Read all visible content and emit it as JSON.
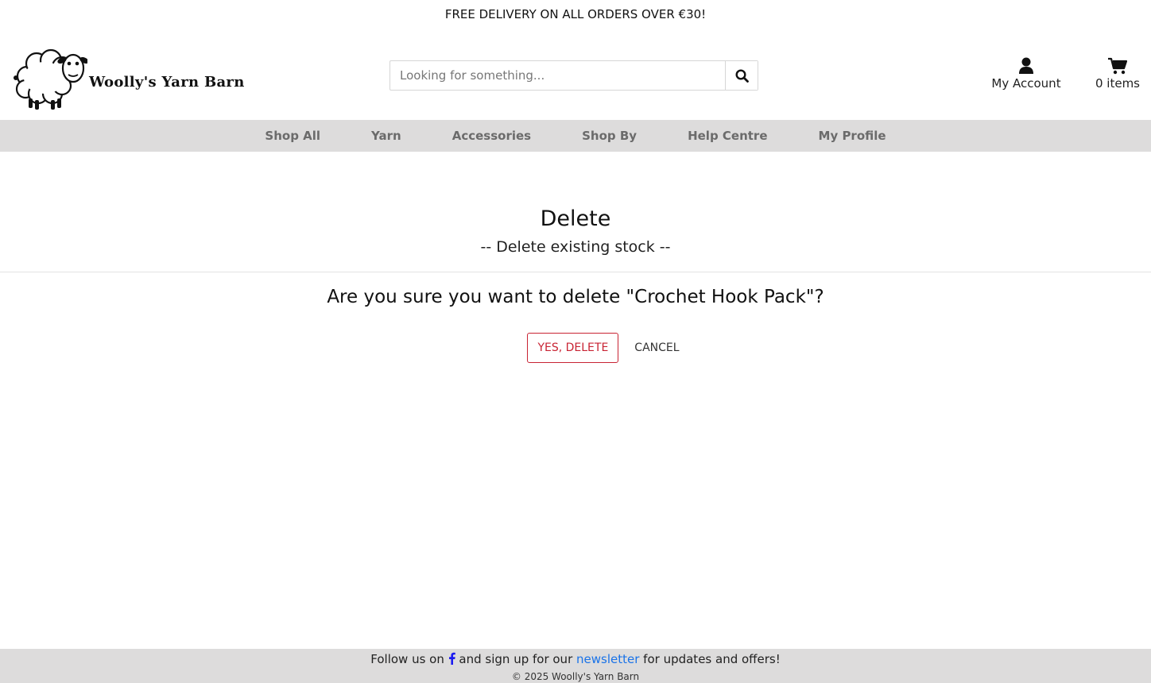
{
  "promo": {
    "text": "FREE DELIVERY ON ALL ORDERS OVER €30!"
  },
  "header": {
    "logo_text": "Woolly's Yarn Barn",
    "search": {
      "placeholder": "Looking for something...",
      "value": "",
      "button_icon": "search-icon"
    },
    "account": {
      "label": "My Account",
      "icon": "user-icon"
    },
    "cart": {
      "label": "0 items",
      "icon": "cart-icon"
    }
  },
  "nav": {
    "items": [
      {
        "label": "Shop All"
      },
      {
        "label": "Yarn"
      },
      {
        "label": "Accessories"
      },
      {
        "label": "Shop By"
      },
      {
        "label": "Help Centre"
      },
      {
        "label": "My Profile"
      }
    ]
  },
  "page": {
    "title": "Delete",
    "subtitle": "-- Delete existing stock --",
    "confirm_text": "Are you sure you want to delete \"Crochet Hook Pack\"?",
    "confirm_button": "YES, DELETE",
    "cancel_button": "CANCEL"
  },
  "footer": {
    "follow_prefix": "Follow us on",
    "follow_middle": "and sign up for our",
    "newsletter_link": "newsletter",
    "follow_suffix": "for updates and offers!",
    "social_icon": "facebook-icon",
    "copyright": "© 2025 Woolly's Yarn Barn"
  },
  "colors": {
    "nav_background": "#dddcdc",
    "danger": "#c82333",
    "link": "#1a73e8",
    "facebook": "#1877f2"
  }
}
